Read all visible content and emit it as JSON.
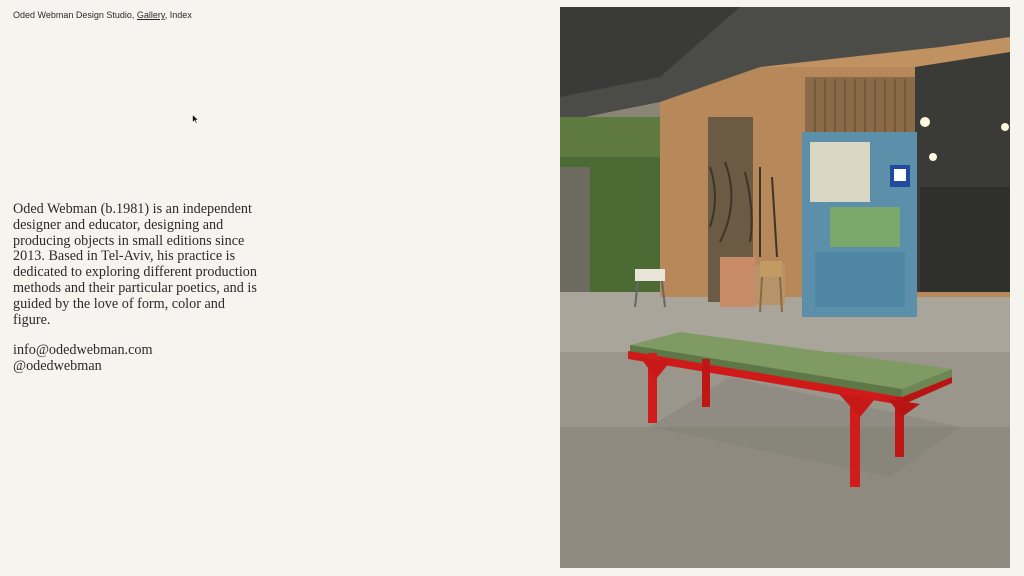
{
  "nav": {
    "studio": "Oded Webman Design Studio,",
    "gallery": "Gallery",
    "separator": ",",
    "index": "Index"
  },
  "bio": {
    "text": "Oded Webman (b.1981) is an independent designer and educator, designing and producing objects in small editions since 2013. Based in Tel-Aviv, his practice is dedicated to exploring different production methods and their particular poetics, and is guided by the love of form, color and figure."
  },
  "contact": {
    "email": "info@odedwebman.com",
    "instagram": "@odedwebman"
  },
  "image": {
    "subject": "red and green bench in industrial workshop"
  }
}
